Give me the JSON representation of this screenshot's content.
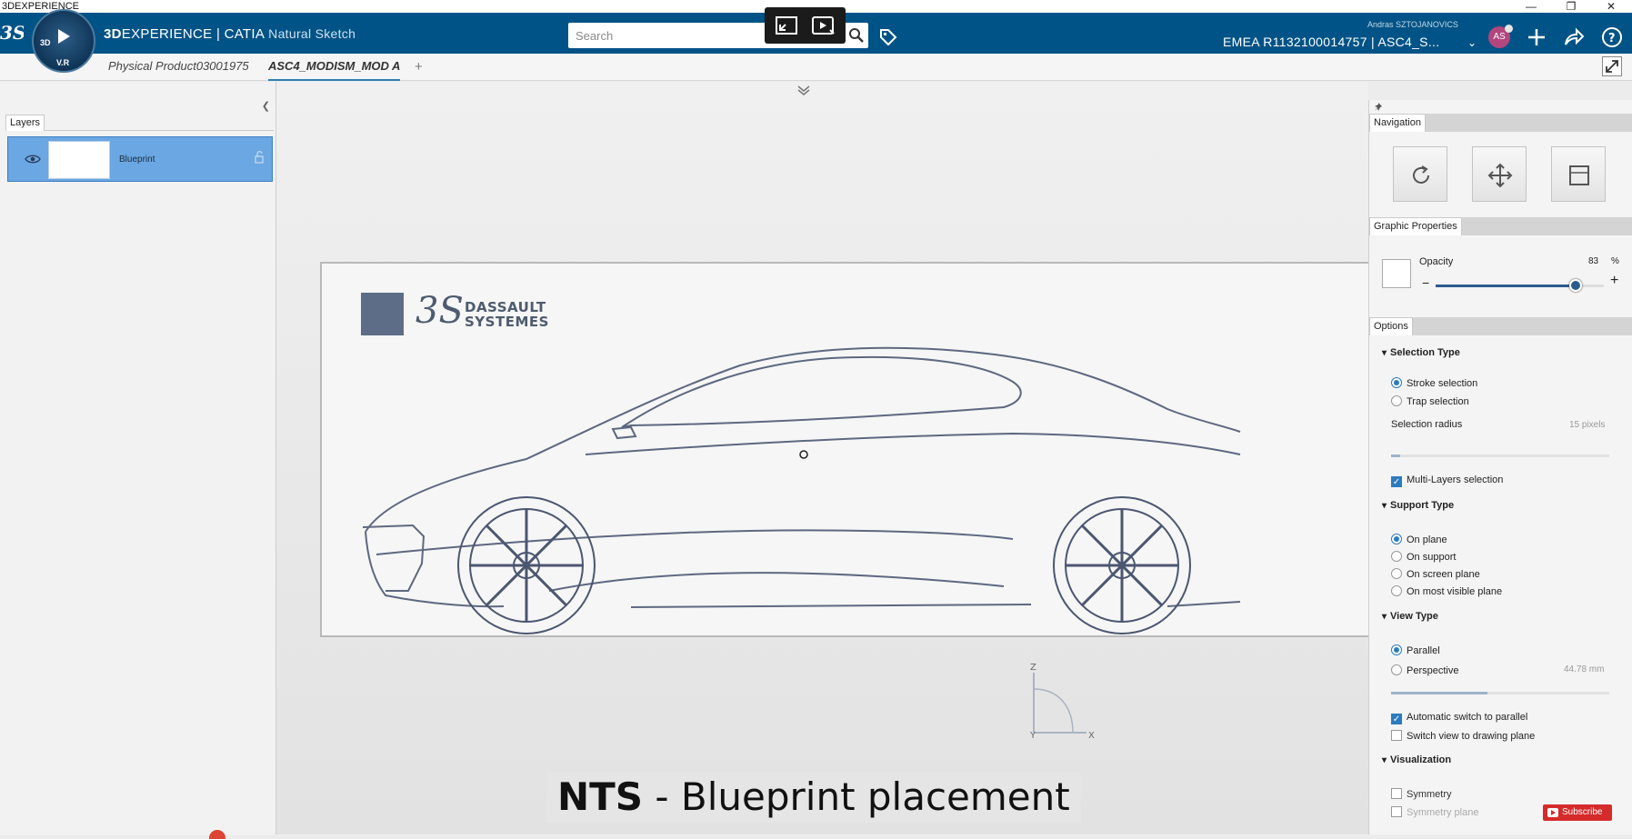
{
  "os_window": {
    "title": "3DEXPERIENCE",
    "minimize": "—",
    "restore": "❐",
    "close": "✕"
  },
  "header": {
    "brand_bold": "3D",
    "brand_rest": "EXPERIENCE | CATIA",
    "app_name": "Natural Sketch",
    "compass_labels": [
      "3D",
      "V.R"
    ],
    "search_placeholder": "Search",
    "user_name": "Andras SZTOJANOVICS",
    "tenant": "EMEA R1132100014757 | ASC4_S...",
    "avatar_initials": "AS",
    "icons": [
      "search-icon",
      "tag-icon",
      "add-icon",
      "share-icon",
      "help-icon"
    ]
  },
  "tabs": [
    {
      "label": "Physical Product03001975",
      "active": false
    },
    {
      "label": "ASC4_MODISM_MOD A",
      "active": true
    }
  ],
  "left_panel": {
    "tab_label": "Layers",
    "layers": [
      {
        "name": "Blueprint",
        "visible": true
      }
    ]
  },
  "blueprint": {
    "logo_line1": "DASSAULT",
    "logo_line2": "SYSTEMES",
    "logo_mark": "3S"
  },
  "right_panel": {
    "navigation_label": "Navigation",
    "graphic_properties_label": "Graphic Properties",
    "opacity_label": "Opacity",
    "opacity_value": "83",
    "opacity_unit": "%",
    "opacity_fraction": 0.83,
    "options_label": "Options",
    "selection_type_label": "Selection Type",
    "stroke_selection": "Stroke selection",
    "trap_selection": "Trap selection",
    "selection_radius_label": "Selection radius",
    "selection_radius_value": "15 pixels",
    "multi_layers": "Multi-Layers selection",
    "support_type_label": "Support Type",
    "on_plane": "On plane",
    "on_support": "On support",
    "on_screen_plane": "On screen plane",
    "on_most_visible_plane": "On most visible plane",
    "view_type_label": "View Type",
    "parallel": "Parallel",
    "perspective": "Perspective",
    "perspective_value": "44.78 mm",
    "auto_switch": "Automatic switch to parallel",
    "switch_view": "Switch view to drawing plane",
    "visualization_label": "Visualization",
    "symmetry": "Symmetry",
    "symmetry_plane": "Symmetry plane"
  },
  "caption": {
    "bold": "NTS",
    "rest": " - Blueprint placement"
  },
  "subscribe_label": "Subscribe",
  "triad": {
    "z": "Z",
    "y": "Y",
    "x": "X"
  }
}
